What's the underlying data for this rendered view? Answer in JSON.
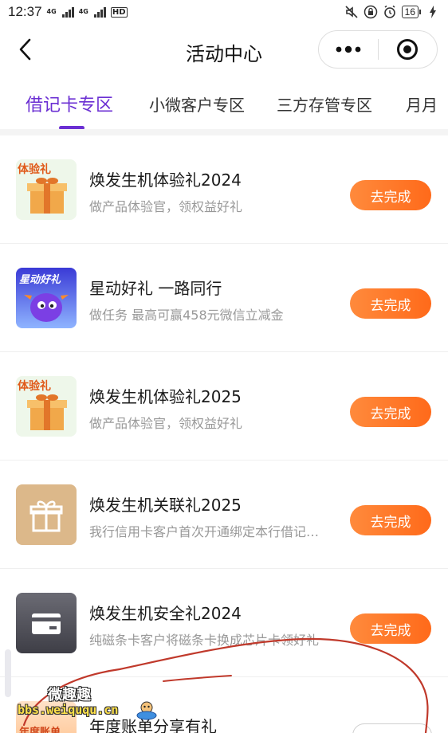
{
  "status_bar": {
    "time": "12:37",
    "net1": "4G",
    "net2": "4G",
    "hd": "HD",
    "battery": "16"
  },
  "nav": {
    "title": "活动中心",
    "back_icon": "chevron-left-icon",
    "more_icon": "more-dots-icon",
    "close_icon": "target-close-icon"
  },
  "tabs": [
    {
      "label": "借记卡专区",
      "active": true
    },
    {
      "label": "小微客户专区",
      "active": false
    },
    {
      "label": "三方存管专区",
      "active": false
    },
    {
      "label": "月月",
      "active": false
    }
  ],
  "tasks": [
    {
      "title": "焕发生机体验礼2024",
      "desc": "做产品体验官，领权益好礼",
      "button": "去完成",
      "thumb_text": "体验礼",
      "thumb_icon": "gift-box-icon"
    },
    {
      "title": "星动好礼 一路同行",
      "desc": "做任务 最高可赢458元微信立减金",
      "button": "去完成",
      "thumb_text": "星动好礼",
      "thumb_icon": "star-mascot-icon"
    },
    {
      "title": "焕发生机体验礼2025",
      "desc": "做产品体验官，领权益好礼",
      "button": "去完成",
      "thumb_text": "体验礼",
      "thumb_icon": "gift-box-icon"
    },
    {
      "title": "焕发生机关联礼2025",
      "desc": "我行信用卡客户首次开通绑定本行借记卡自动还款",
      "button": "去完成",
      "thumb_icon": "gift-icon"
    },
    {
      "title": "焕发生机安全礼2024",
      "desc": "纯磁条卡客户将磁条卡换成芯片卡领好礼",
      "button": "去完成",
      "thumb_icon": "card-icon"
    }
  ],
  "last_task": {
    "title": "年度账单分享有礼",
    "thumb_text": "年度账单"
  },
  "watermark": {
    "line1": "微趣趣",
    "line2": "bbs.weiququ.cn"
  },
  "colors": {
    "accent": "#6b2fd3",
    "button": "#ff7a2b",
    "scribble": "#c0392b"
  }
}
